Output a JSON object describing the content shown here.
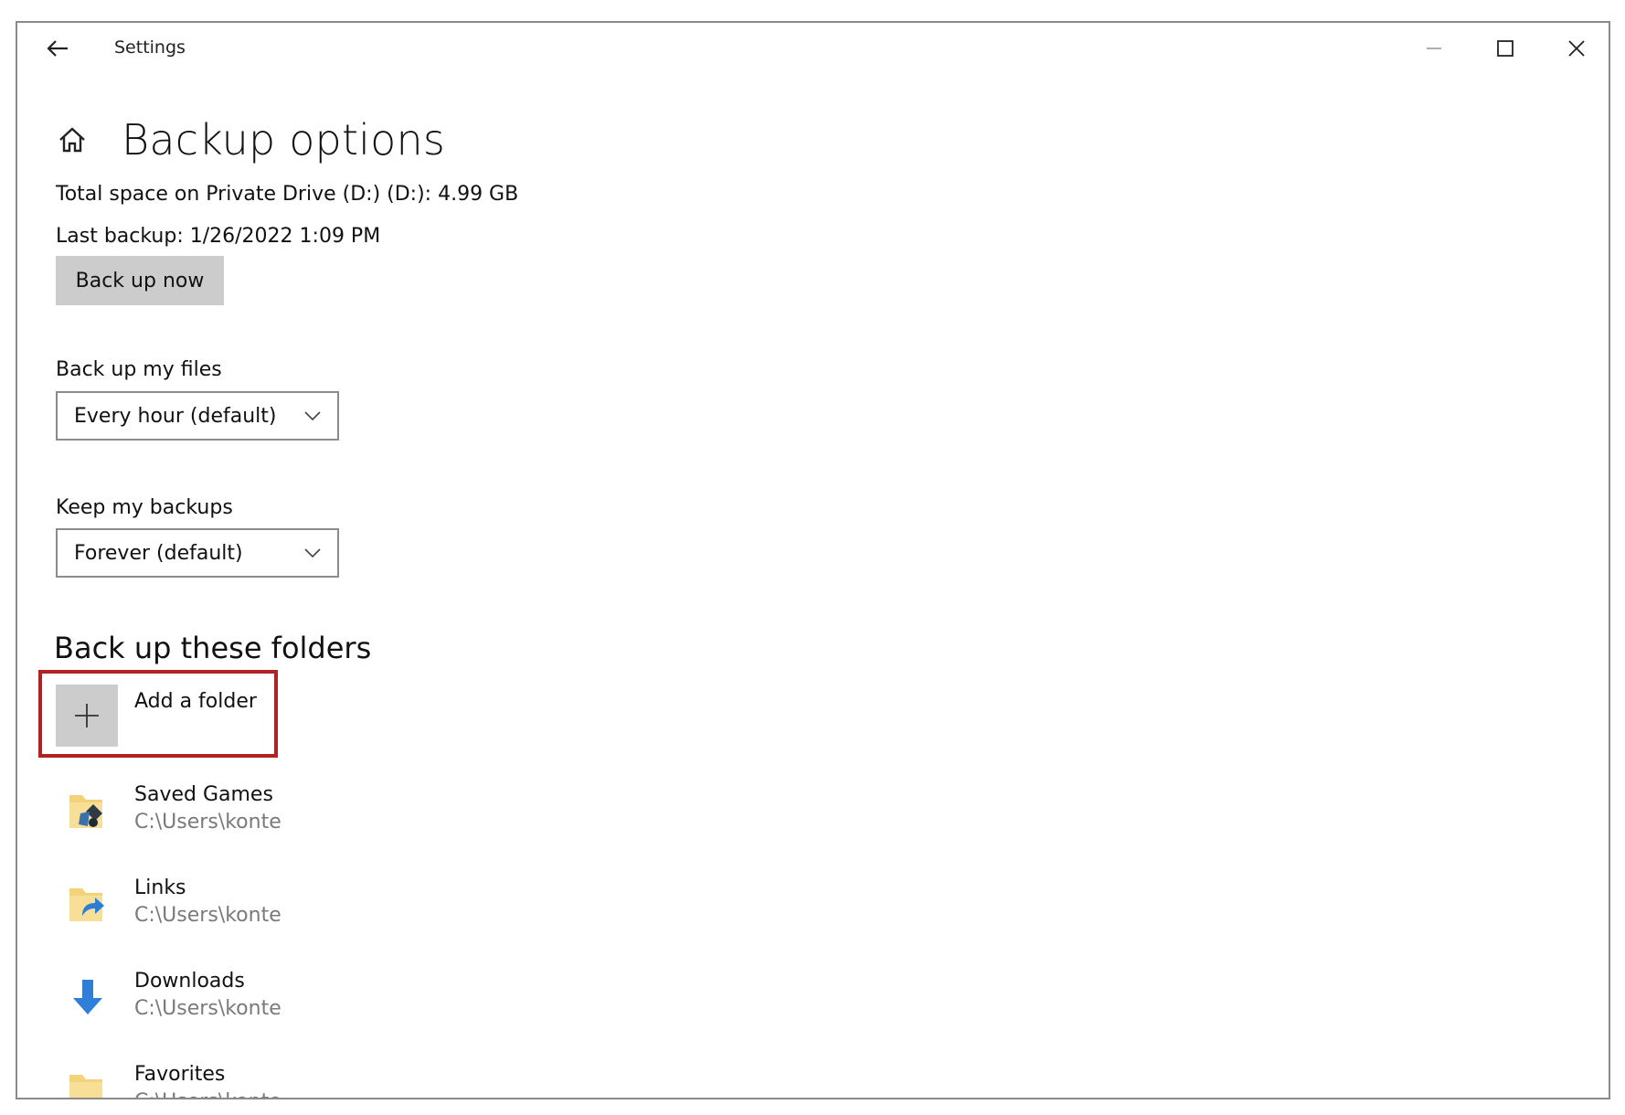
{
  "window": {
    "title": "Settings"
  },
  "page": {
    "title": "Backup options",
    "total_space": "Total space on Private Drive (D:) (D:): 4.99 GB",
    "last_backup": "Last backup: 1/26/2022 1:09 PM",
    "back_up_now_label": "Back up now"
  },
  "backup_frequency": {
    "label": "Back up my files",
    "value": "Every hour (default)"
  },
  "retention": {
    "label": "Keep my backups",
    "value": "Forever (default)"
  },
  "folders_section": {
    "title": "Back up these folders",
    "add_label": "Add a folder",
    "highlight_color": "#b22222",
    "items": [
      {
        "name": "Saved Games",
        "path": "C:\\Users\\konte",
        "icon": "saved-games-folder-icon"
      },
      {
        "name": "Links",
        "path": "C:\\Users\\konte",
        "icon": "links-folder-icon"
      },
      {
        "name": "Downloads",
        "path": "C:\\Users\\konte",
        "icon": "downloads-folder-icon"
      },
      {
        "name": "Favorites",
        "path": "C:\\Users\\konte",
        "icon": "favorites-folder-icon"
      }
    ]
  }
}
